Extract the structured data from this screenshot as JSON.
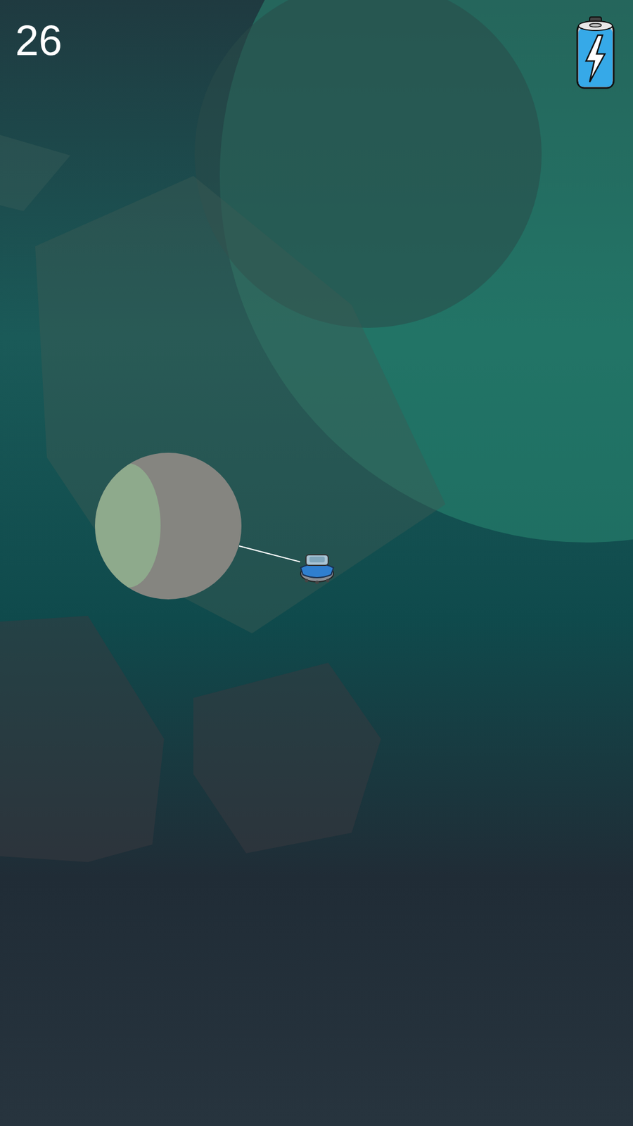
{
  "hud": {
    "score": "26",
    "battery": {
      "level": 1
    }
  },
  "tether": {
    "attached": true
  }
}
